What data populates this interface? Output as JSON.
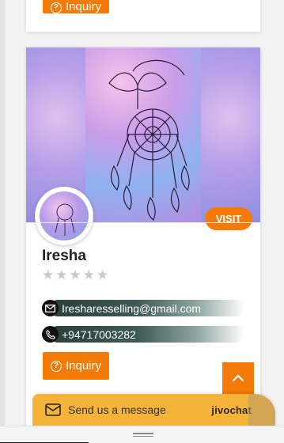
{
  "top_card": {
    "inquiry_label": "Inquiry"
  },
  "profile": {
    "name": "Iresha",
    "visit_label": "VISIT",
    "rating_max": 5,
    "rating_value": 0,
    "email": "Iresharesselling@gmail.com",
    "phone": "+94717003282",
    "inquiry_label": "Inquiry"
  },
  "chat": {
    "label": "Send us a message",
    "brand": "jivochat"
  },
  "colors": {
    "accent": "#f47b07",
    "chat_bar": "#f6b33a"
  },
  "icons": {
    "inquiry": "question-circle-icon",
    "email": "envelope-icon",
    "phone": "phone-icon",
    "scroll_top": "chevron-up-icon",
    "chat": "message-icon"
  }
}
